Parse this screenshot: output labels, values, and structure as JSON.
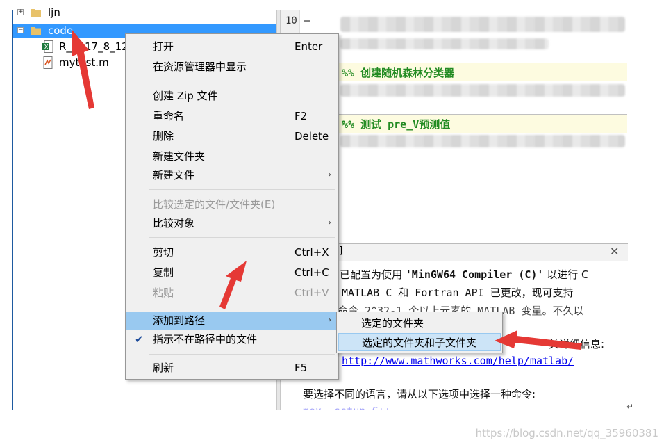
{
  "tree": {
    "items": [
      {
        "label": "ljn"
      },
      {
        "label": "code"
      },
      {
        "label": "R_2017_8_12."
      },
      {
        "label": "mytest.m"
      }
    ]
  },
  "editor": {
    "line_number": "10",
    "line_dash": "—",
    "cell1": "%% 创建随机森林分类器",
    "cell2": "%% 测试 pre_V预测值"
  },
  "command_window": {
    "header_glyph": "]",
    "lines": [
      {
        "pre": "已配置为使用 ",
        "bold": "'MinGW64 Compiler (C)'",
        "post": " 以进行 C"
      },
      {
        "pre": "MATLAB C 和 Fortran API 已更改，现可支持"
      },
      {
        "pre": "命令 2^32-1 个以上元素的 MATLAB 变量。不久以"
      },
      {
        "pre": "关详细信息:"
      },
      {
        "link": "http://www.mathworks.com/help/matlab/"
      },
      {
        "pre": "要选择不同的语言，请从以下选项中选择一种命令:"
      },
      {
        "pre": " mex -setup C++"
      }
    ]
  },
  "context_menu": {
    "items": [
      {
        "label": "打开",
        "shortcut": "Enter"
      },
      {
        "label": "在资源管理器中显示",
        "shortcut": ""
      },
      {
        "label": "创建 Zip 文件",
        "shortcut": ""
      },
      {
        "label": "重命名",
        "shortcut": "F2"
      },
      {
        "label": "删除",
        "shortcut": "Delete"
      },
      {
        "label": "新建文件夹",
        "shortcut": ""
      },
      {
        "label": "新建文件",
        "shortcut": ""
      },
      {
        "label": "比较选定的文件/文件夹(E)",
        "shortcut": ""
      },
      {
        "label": "比较对象",
        "shortcut": ""
      },
      {
        "label": "剪切",
        "shortcut": "Ctrl+X"
      },
      {
        "label": "复制",
        "shortcut": "Ctrl+C"
      },
      {
        "label": "粘贴",
        "shortcut": "Ctrl+V"
      },
      {
        "label": "添加到路径",
        "shortcut": ""
      },
      {
        "label": "指示不在路径中的文件",
        "shortcut": ""
      },
      {
        "label": "刷新",
        "shortcut": "F5"
      }
    ],
    "submenu_arrow": "›",
    "check": "✔"
  },
  "submenu": {
    "items": [
      {
        "label": "选定的文件夹"
      },
      {
        "label": "选定的文件夹和子文件夹"
      }
    ]
  },
  "watermark": "https://blog.csdn.net/qq_35960381",
  "colors": {
    "selection": "#3399ff",
    "menu_highlight": "#99c9f0",
    "annotation_arrow": "#e53935",
    "cell_comment": "#228b22"
  }
}
